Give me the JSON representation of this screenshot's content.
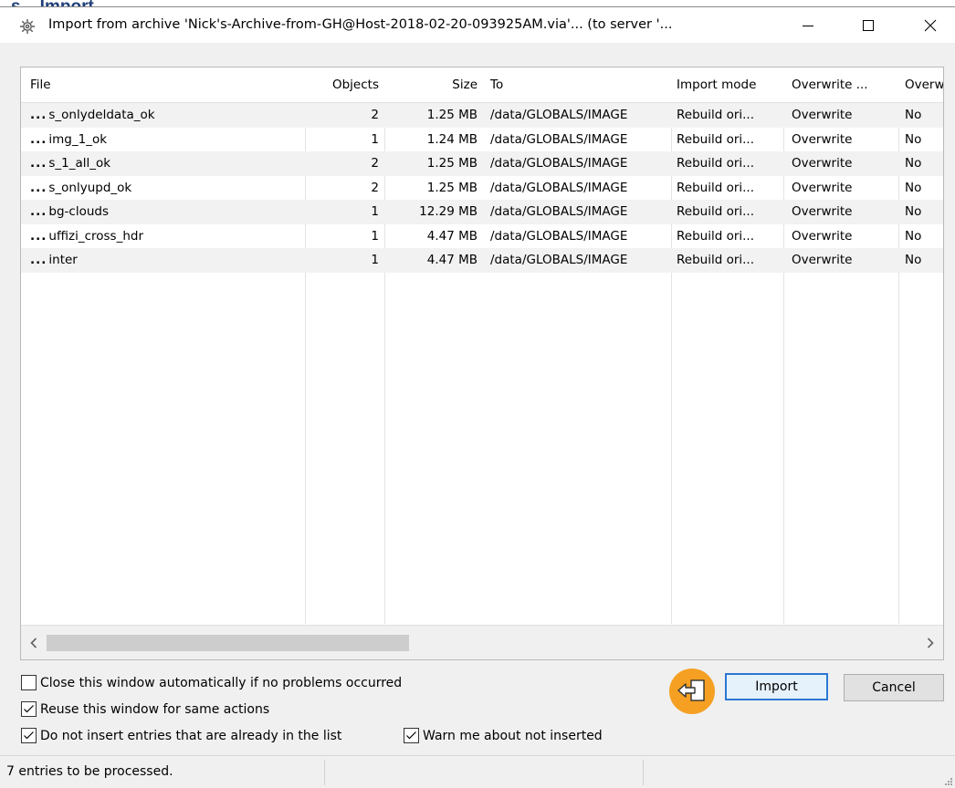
{
  "background_strip": "s .. Import",
  "window": {
    "title": "Import from archive 'Nick's-Archive-from-GH@Host-2018-02-20-093925AM.via'... (to server '...",
    "controls": {
      "minimize_icon": "minimize-icon",
      "maximize_icon": "maximize-icon",
      "close_icon": "close-icon"
    }
  },
  "table": {
    "columns": [
      "File",
      "Objects",
      "Size",
      "To",
      "Import mode",
      "Overwrite ...",
      "Overw"
    ],
    "rows": [
      {
        "file": "s_onlydeldata_ok",
        "objects": "2",
        "size": "1.25 MB",
        "to": "/data/GLOBALS/IMAGE",
        "mode": "Rebuild ori...",
        "overwrite": "Overwrite",
        "overw": "No"
      },
      {
        "file": "img_1_ok",
        "objects": "1",
        "size": "1.24 MB",
        "to": "/data/GLOBALS/IMAGE",
        "mode": "Rebuild ori...",
        "overwrite": "Overwrite",
        "overw": "No"
      },
      {
        "file": "s_1_all_ok",
        "objects": "2",
        "size": "1.25 MB",
        "to": "/data/GLOBALS/IMAGE",
        "mode": "Rebuild ori...",
        "overwrite": "Overwrite",
        "overw": "No"
      },
      {
        "file": "s_onlyupd_ok",
        "objects": "2",
        "size": "1.25 MB",
        "to": "/data/GLOBALS/IMAGE",
        "mode": "Rebuild ori...",
        "overwrite": "Overwrite",
        "overw": "No"
      },
      {
        "file": "bg-clouds",
        "objects": "1",
        "size": "12.29 MB",
        "to": "/data/GLOBALS/IMAGE",
        "mode": "Rebuild ori...",
        "overwrite": "Overwrite",
        "overw": "No"
      },
      {
        "file": "uffizi_cross_hdr",
        "objects": "1",
        "size": "4.47 MB",
        "to": "/data/GLOBALS/IMAGE",
        "mode": "Rebuild ori...",
        "overwrite": "Overwrite",
        "overw": "No"
      },
      {
        "file": "inter",
        "objects": "1",
        "size": "4.47 MB",
        "to": "/data/GLOBALS/IMAGE",
        "mode": "Rebuild ori...",
        "overwrite": "Overwrite",
        "overw": "No"
      }
    ],
    "row_prefix": "..."
  },
  "options": {
    "close_auto": {
      "label": "Close this window automatically if no problems occurred",
      "checked": false
    },
    "reuse": {
      "label": "Reuse this window for same actions",
      "checked": true
    },
    "no_dupes": {
      "label": "Do not insert entries that are already in the list",
      "checked": true
    },
    "warn": {
      "label": "Warn me about not inserted",
      "checked": true
    }
  },
  "buttons": {
    "import": "Import",
    "cancel": "Cancel"
  },
  "status": {
    "text": "7 entries to be processed."
  },
  "colors": {
    "accent": "#2b78d4",
    "tip_icon": "#f5a023",
    "alt_row": "#f2f2f2"
  }
}
